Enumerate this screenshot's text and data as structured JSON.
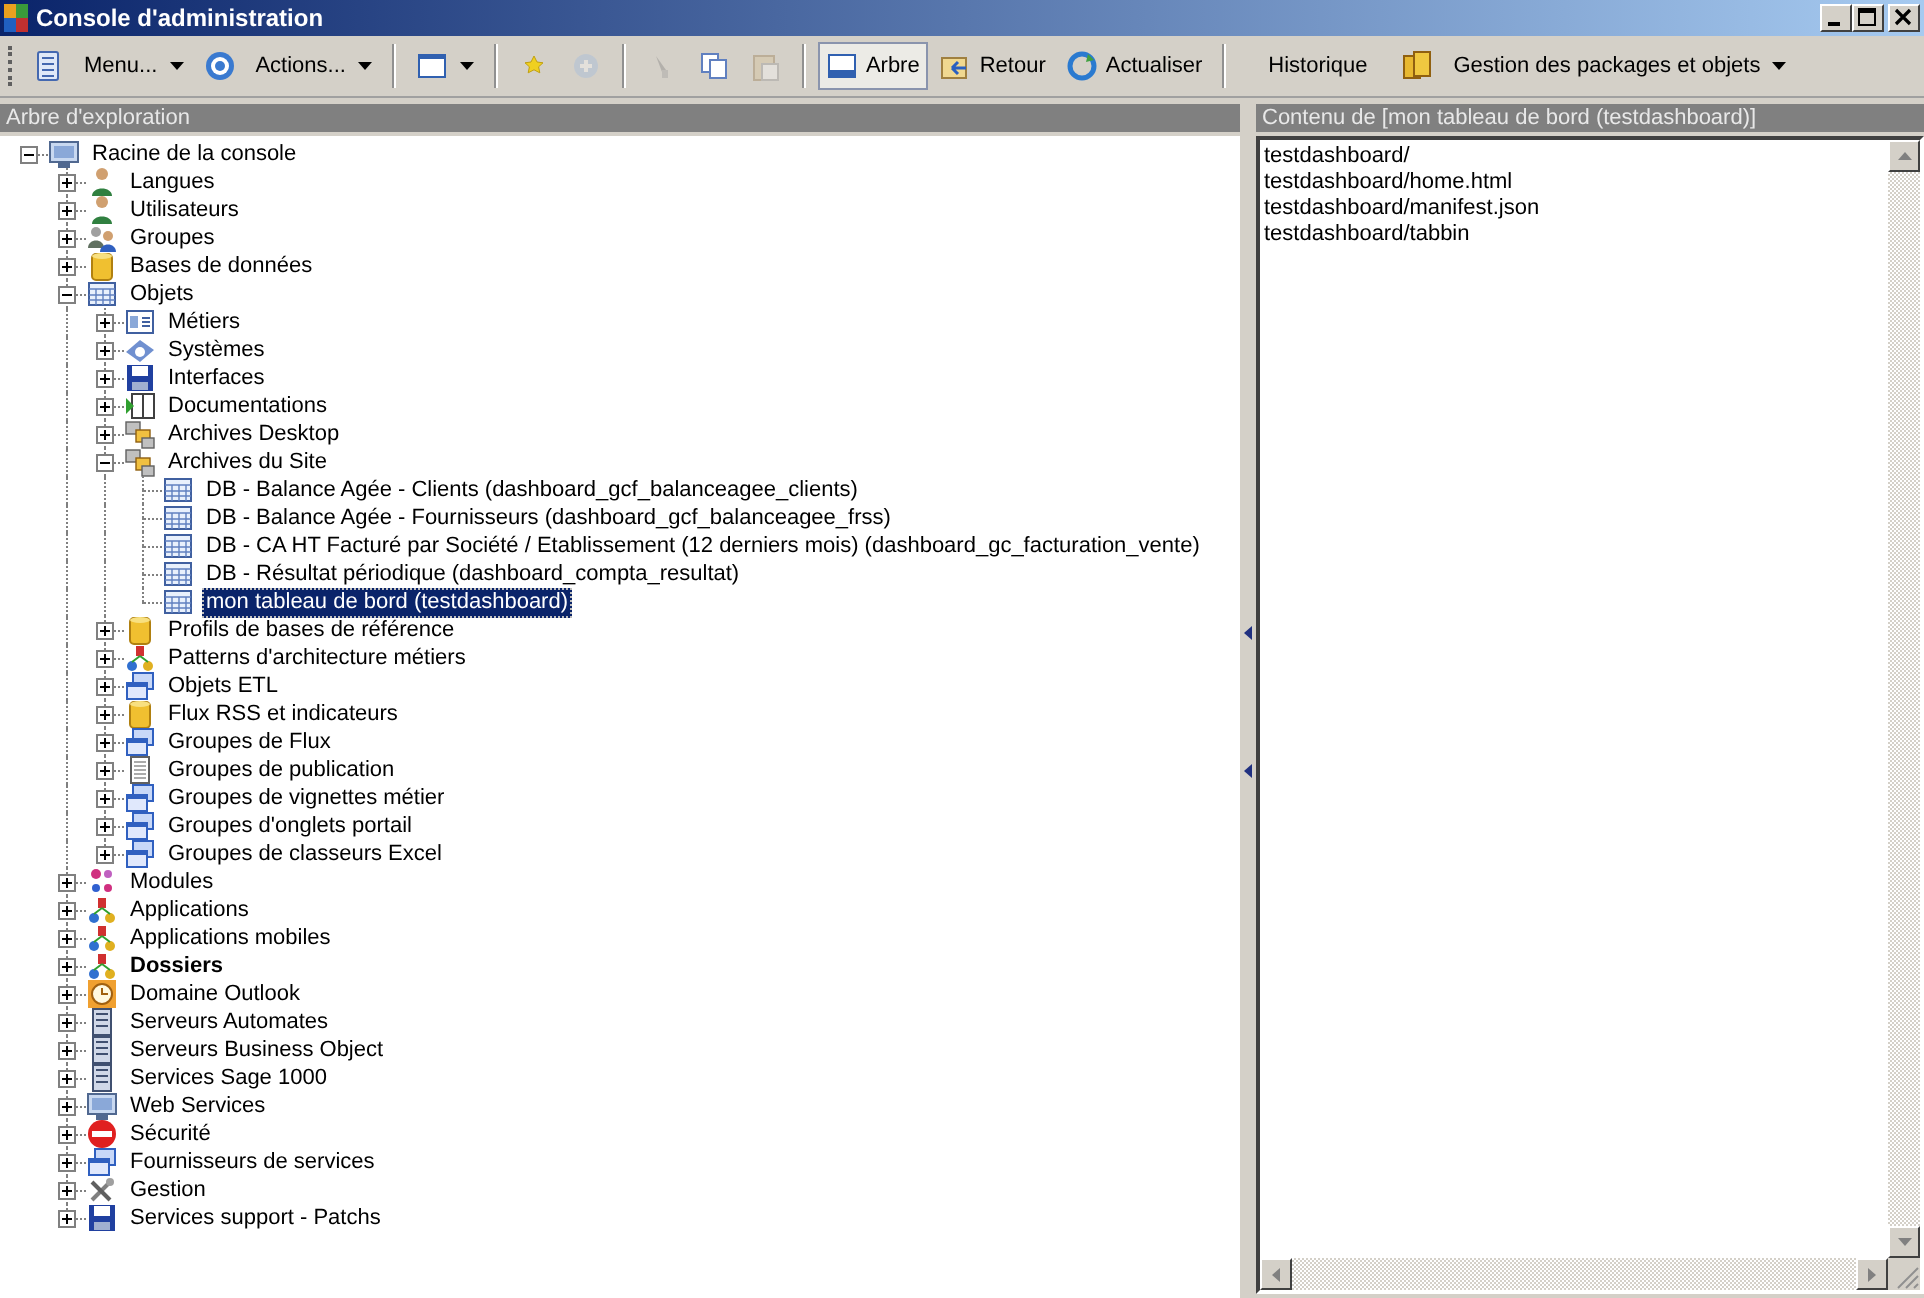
{
  "window": {
    "title": "Console d'administration"
  },
  "toolbar": [
    {
      "kind": "icon",
      "disabled": false
    },
    {
      "kind": "dropdown",
      "label": "Menu..."
    },
    {
      "kind": "icon",
      "disabled": false
    },
    {
      "kind": "dropdown",
      "label": "Actions..."
    },
    {
      "kind": "separator"
    },
    {
      "kind": "split"
    },
    {
      "kind": "separator"
    },
    {
      "kind": "icon",
      "disabled": false
    },
    {
      "kind": "icon",
      "disabled": true
    },
    {
      "kind": "separator"
    },
    {
      "kind": "icon",
      "disabled": true
    },
    {
      "kind": "icon",
      "disabled": false
    },
    {
      "kind": "icon",
      "disabled": true
    },
    {
      "kind": "separator"
    },
    {
      "kind": "button",
      "label": "Arbre",
      "selected": true
    },
    {
      "kind": "button",
      "label": "Retour",
      "selected": false
    },
    {
      "kind": "button",
      "label": "Actualiser",
      "selected": false
    },
    {
      "kind": "separator"
    },
    {
      "kind": "text",
      "label": "Historique"
    },
    {
      "kind": "icon",
      "disabled": false
    },
    {
      "kind": "dropdown",
      "label": "Gestion des packages et objets"
    }
  ],
  "explorer": {
    "title": "Arbre d'exploration",
    "tree": [
      {
        "label": "Racine de la console",
        "expanded": true,
        "selected": false,
        "children": [
          {
            "label": "Langues",
            "expanded": false,
            "selected": false
          },
          {
            "label": "Utilisateurs",
            "expanded": false,
            "selected": false
          },
          {
            "label": "Groupes",
            "expanded": false,
            "selected": false
          },
          {
            "label": "Bases de données",
            "expanded": false,
            "selected": false
          },
          {
            "label": "Objets",
            "expanded": true,
            "selected": false,
            "children": [
              {
                "label": "Métiers",
                "expanded": false,
                "selected": false
              },
              {
                "label": "Systèmes",
                "expanded": false,
                "selected": false
              },
              {
                "label": "Interfaces",
                "expanded": false,
                "selected": false
              },
              {
                "label": "Documentations",
                "expanded": false,
                "selected": false
              },
              {
                "label": "Archives Desktop",
                "expanded": false,
                "selected": false
              },
              {
                "label": "Archives du Site",
                "expanded": true,
                "selected": false,
                "children": [
                  {
                    "label": "DB - Balance Agée - Clients (dashboard_gcf_balanceagee_clients)",
                    "selected": false
                  },
                  {
                    "label": "DB - Balance Agée - Fournisseurs (dashboard_gcf_balanceagee_frss)",
                    "selected": false
                  },
                  {
                    "label": "DB - CA HT Facturé par Société / Etablissement (12 derniers mois) (dashboard_gc_facturation_vente)",
                    "selected": false
                  },
                  {
                    "label": "DB - Résultat périodique (dashboard_compta_resultat)",
                    "selected": false
                  },
                  {
                    "label": "mon tableau de bord (testdashboard)",
                    "selected": true
                  }
                ]
              },
              {
                "label": "Profils de bases de référence",
                "expanded": false,
                "selected": false
              },
              {
                "label": "Patterns d'architecture métiers",
                "expanded": false,
                "selected": false
              },
              {
                "label": "Objets ETL",
                "expanded": false,
                "selected": false
              },
              {
                "label": "Flux RSS et indicateurs",
                "expanded": false,
                "selected": false
              },
              {
                "label": "Groupes de Flux",
                "expanded": false,
                "selected": false
              },
              {
                "label": "Groupes de publication",
                "expanded": false,
                "selected": false
              },
              {
                "label": "Groupes de vignettes métier",
                "expanded": false,
                "selected": false
              },
              {
                "label": "Groupes d'onglets portail",
                "expanded": false,
                "selected": false
              },
              {
                "label": "Groupes de classeurs Excel",
                "expanded": false,
                "selected": false
              }
            ]
          },
          {
            "label": "Modules",
            "expanded": false,
            "selected": false
          },
          {
            "label": "Applications",
            "expanded": false,
            "selected": false
          },
          {
            "label": "Applications mobiles",
            "expanded": false,
            "selected": false
          },
          {
            "label": "Dossiers",
            "expanded": false,
            "selected": false,
            "bold": true
          },
          {
            "label": "Domaine Outlook",
            "expanded": false,
            "selected": false
          },
          {
            "label": "Serveurs Automates",
            "expanded": false,
            "selected": false
          },
          {
            "label": "Serveurs Business Object",
            "expanded": false,
            "selected": false
          },
          {
            "label": "Services Sage 1000",
            "expanded": false,
            "selected": false
          },
          {
            "label": "Web Services",
            "expanded": false,
            "selected": false
          },
          {
            "label": "Sécurité",
            "expanded": false,
            "selected": false
          },
          {
            "label": "Fournisseurs de services",
            "expanded": false,
            "selected": false
          },
          {
            "label": "Gestion",
            "expanded": false,
            "selected": false
          },
          {
            "label": "Services support - Patchs",
            "expanded": false,
            "selected": false
          }
        ]
      }
    ]
  },
  "content_panel": {
    "title": "Contenu de [mon tableau de bord (testdashboard)]",
    "items": [
      "testdashboard/",
      "testdashboard/home.html",
      "testdashboard/manifest.json",
      "testdashboard/tabbin"
    ]
  }
}
